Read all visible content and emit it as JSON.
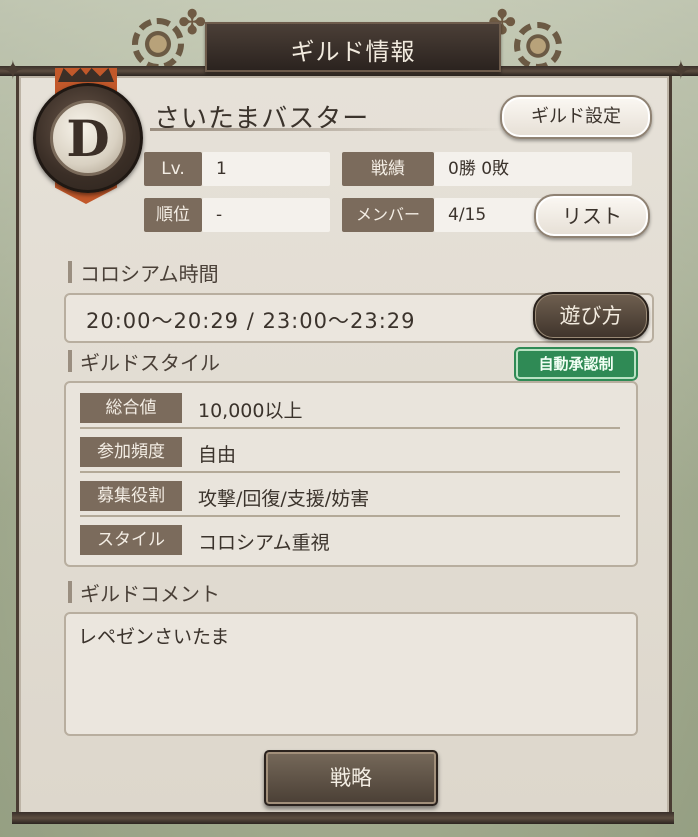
{
  "window": {
    "title": "ギルド情報"
  },
  "emblem": {
    "rank_letter": "D",
    "banner_color": "#c2582a"
  },
  "guild": {
    "name": "さいたまバスター",
    "settings_button": "ギルド設定"
  },
  "stats": {
    "level_label": "Lv.",
    "level_value": "1",
    "record_label": "戦績",
    "record_value": "0勝 0敗",
    "rank_label": "順位",
    "rank_value": "-",
    "members_label": "メンバー",
    "members_value": "4/15",
    "list_button": "リスト"
  },
  "colosseum": {
    "section_label": "コロシアム時間",
    "time_text": "20:00〜20:29  /  23:00〜23:29",
    "howto_button": "遊び方"
  },
  "guild_style": {
    "section_label": "ギルドスタイル",
    "auto_approve_badge": "自動承認制",
    "rows": [
      {
        "label": "総合値",
        "value": "10,000以上"
      },
      {
        "label": "参加頻度",
        "value": "自由"
      },
      {
        "label": "募集役割",
        "value": "攻撃/回復/支援/妨害"
      },
      {
        "label": "スタイル",
        "value": "コロシアム重視"
      }
    ]
  },
  "comment": {
    "section_label": "ギルドコメント",
    "text": "レペゼンさいたま"
  },
  "footer": {
    "strategy_button": "戦略"
  },
  "colors": {
    "accent_green": "#2f8a55",
    "label_brown": "#7b6b5c",
    "panel_bg": "#e6e1d8"
  }
}
